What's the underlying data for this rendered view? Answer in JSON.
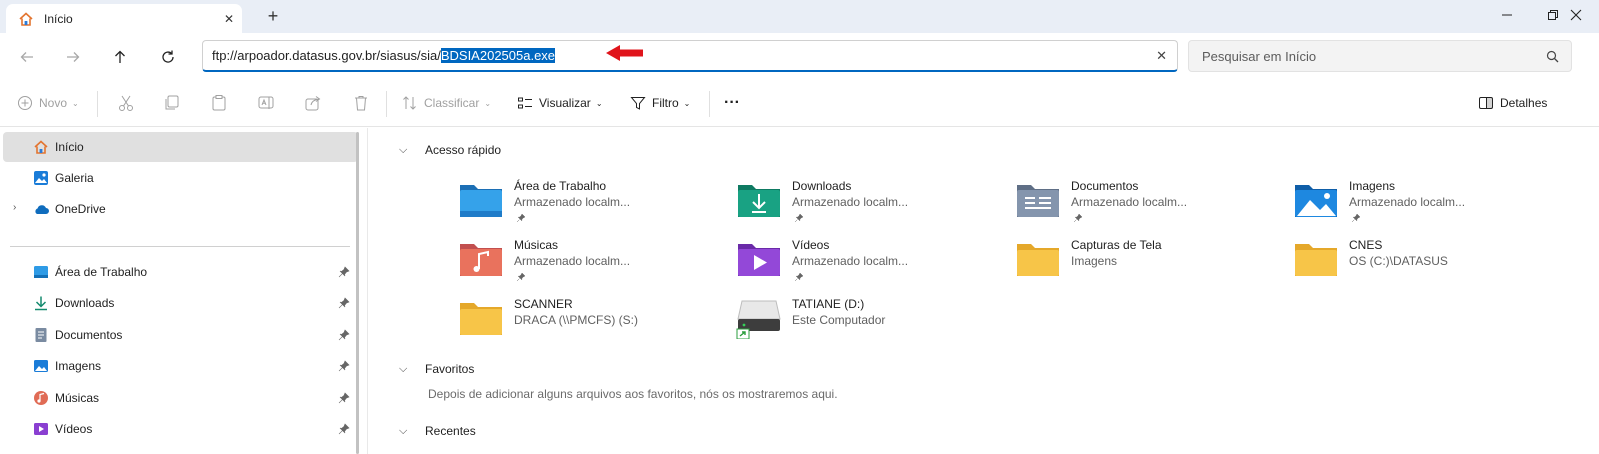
{
  "tab": {
    "title": "Início",
    "close": "✕",
    "new": "+"
  },
  "address": {
    "prefix": "ftp://arpoador.datasus.gov.br/siasus/sia/",
    "selected": "BDSIA202505a.exe",
    "clear": "✕"
  },
  "search": {
    "placeholder": "Pesquisar em Início"
  },
  "commands": {
    "novo": "Novo",
    "classificar": "Classificar",
    "visualizar": "Visualizar",
    "filtro": "Filtro",
    "more": "···",
    "detalhes": "Detalhes"
  },
  "sidebar": {
    "items": [
      {
        "label": "Início"
      },
      {
        "label": "Galeria"
      },
      {
        "label": "OneDrive"
      },
      {
        "label": "Área de Trabalho"
      },
      {
        "label": "Downloads"
      },
      {
        "label": "Documentos"
      },
      {
        "label": "Imagens"
      },
      {
        "label": "Músicas"
      },
      {
        "label": "Vídeos"
      }
    ]
  },
  "main": {
    "quick_access_title": "Acesso rápido",
    "favorites_title": "Favoritos",
    "favorites_empty": "Depois de adicionar alguns arquivos aos favoritos, nós os mostraremos aqui.",
    "recent_title": "Recentes",
    "tiles": [
      {
        "name": "Área de Trabalho",
        "sub": "Armazenado localm..."
      },
      {
        "name": "Downloads",
        "sub": "Armazenado localm..."
      },
      {
        "name": "Documentos",
        "sub": "Armazenado localm..."
      },
      {
        "name": "Imagens",
        "sub": "Armazenado localm..."
      },
      {
        "name": "Músicas",
        "sub": "Armazenado localm..."
      },
      {
        "name": "Vídeos",
        "sub": "Armazenado localm..."
      },
      {
        "name": "Capturas de Tela",
        "sub": "Imagens"
      },
      {
        "name": "CNES",
        "sub": "OS (C:)\\DATASUS"
      },
      {
        "name": "SCANNER",
        "sub": "DRACA (\\\\PMCFS) (S:)"
      },
      {
        "name": "TATIANE (D:)",
        "sub": "Este Computador"
      }
    ]
  },
  "colors": {
    "accent": "#0067c0",
    "arrow": "#e0141b",
    "folder": "#f5c242"
  }
}
